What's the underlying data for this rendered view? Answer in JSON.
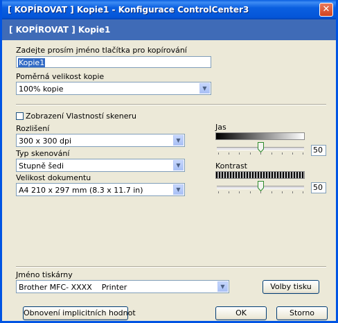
{
  "window": {
    "title": "[ KOPÍROVAT ]  Kopie1 - Konfigurace ControlCenter3",
    "close_glyph": "✕",
    "header": "[ KOPÍROVAT ]  Kopie1"
  },
  "form": {
    "name_label": "Zadejte prosím jméno tlačítka pro kopírování",
    "name_value": "Kopie1",
    "ratio_label": "Poměrná velikost kopie",
    "ratio_value": "100% kopie",
    "scanner_props_label": "Zobrazení Vlastností skeneru",
    "scanner_props_checked": false,
    "resolution_label": "Rozlišení",
    "resolution_value": "300 x 300 dpi",
    "scan_type_label": "Typ skenování",
    "scan_type_value": "Stupně šedi",
    "doc_size_label": "Velikost dokumentu",
    "doc_size_value": "A4 210 x 297 mm (8.3 x 11.7 in)",
    "brightness_label": "Jas",
    "brightness_value": "50",
    "contrast_label": "Kontrast",
    "contrast_value": "50",
    "printer_label": "Jméno tiskárny",
    "printer_value": "Brother MFC- XXXX    Printer",
    "print_options_label": "Volby tisku"
  },
  "buttons": {
    "restore_defaults": "Obnovení implicitních hodnot",
    "ok": "OK",
    "cancel": "Storno"
  },
  "icons": {
    "dropdown": "▼"
  },
  "colors": {
    "title_bar": "#0a5fe0",
    "header_band": "#3f6bb7",
    "close": "#d1421e",
    "selection": "#316ac5"
  }
}
